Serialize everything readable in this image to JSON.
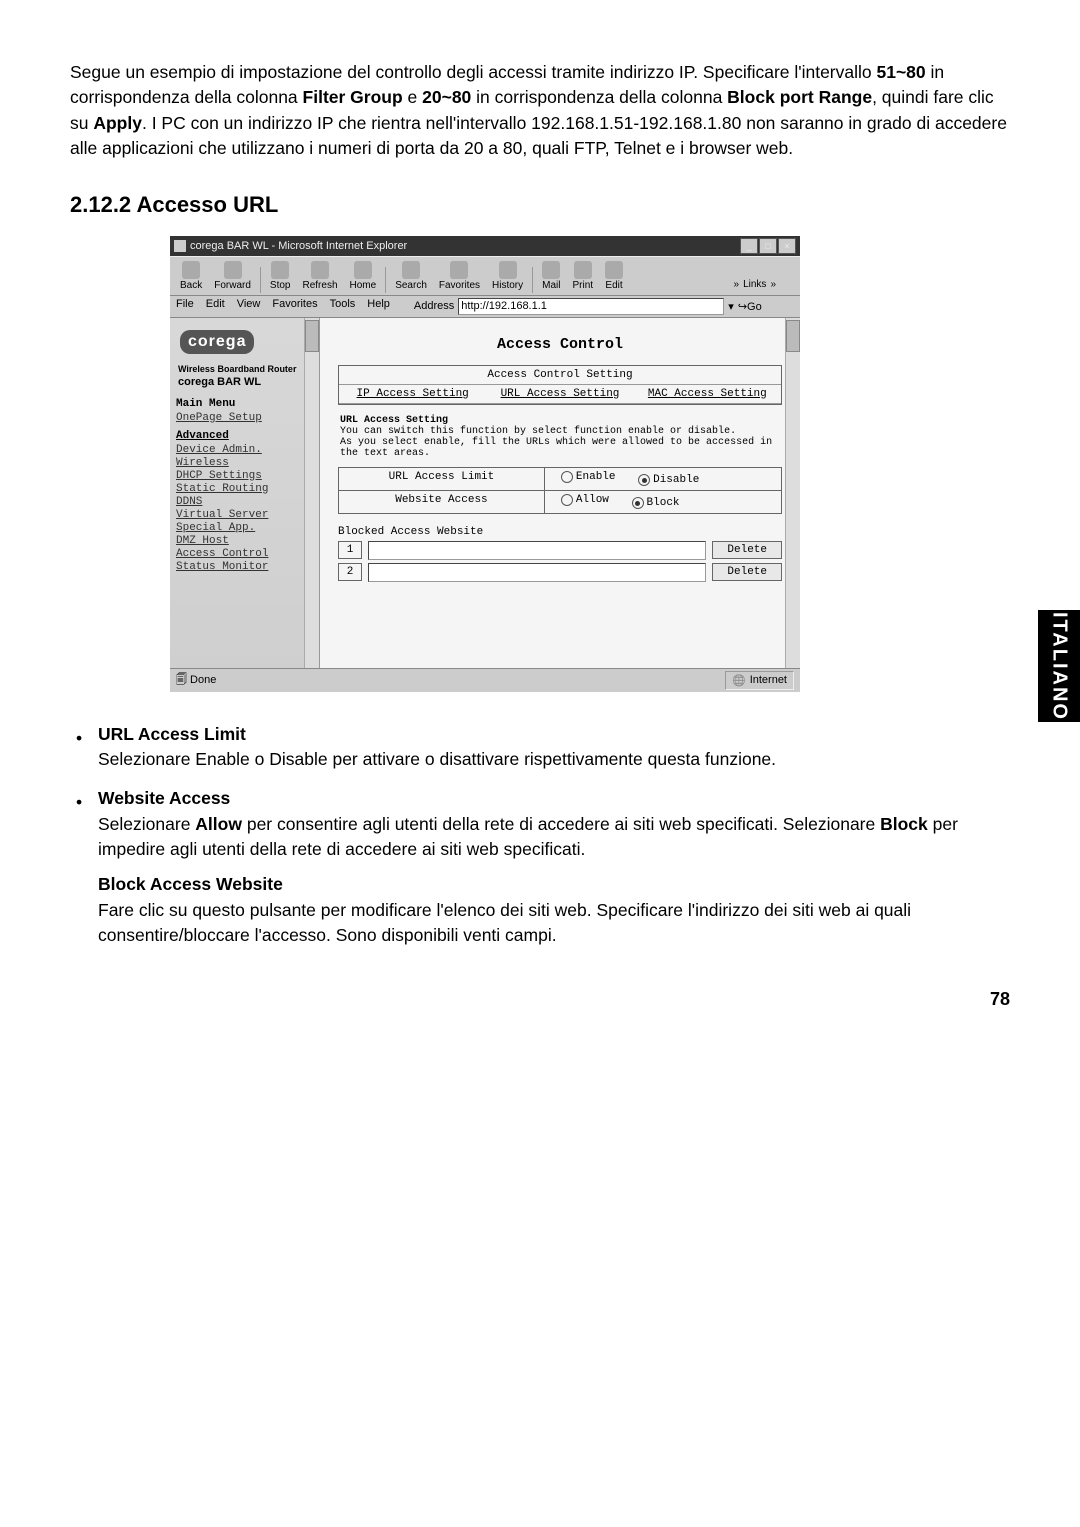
{
  "intro": {
    "p1a": "Segue un esempio di impostazione del controllo degli accessi tramite indirizzo IP. Specificare l'intervallo ",
    "b1": "51~80",
    "p1b": " in corrispondenza della colonna ",
    "b2": "Filter Group",
    "p1c": " e ",
    "b3": "20~80",
    "p1d": " in corrispondenza della colonna ",
    "b4": "Block port Range",
    "p1e": ", quindi fare clic su ",
    "b5": "Apply",
    "p1f": ". I PC con un indirizzo IP che rientra nell'intervallo 192.168.1.51-192.168.1.80 non saranno in grado di accedere alle applicazioni che utilizzano i numeri di porta da 20 a 80, quali FTP, Telnet e i browser web."
  },
  "section_heading": "2.12.2 Accesso URL",
  "screenshot": {
    "titlebar": "corega BAR WL - Microsoft Internet Explorer",
    "toolbar": {
      "back": "Back",
      "forward": "Forward",
      "stop": "Stop",
      "refresh": "Refresh",
      "home": "Home",
      "search": "Search",
      "favorites": "Favorites",
      "history": "History",
      "mail": "Mail",
      "print": "Print",
      "edit": "Edit",
      "links": "Links"
    },
    "menubar": {
      "file": "File",
      "edit": "Edit",
      "view": "View",
      "favorites": "Favorites",
      "tools": "Tools",
      "help": "Help"
    },
    "address_label": "Address",
    "address_value": "http://192.168.1.1",
    "go": "Go",
    "sidebar": {
      "logo": "corega",
      "caption": "Wireless Boardband Router",
      "product": "corega BAR WL",
      "mainmenu": "Main Menu",
      "items": {
        "onepage": "OnePage Setup",
        "advanced": "Advanced",
        "device": "Device Admin.",
        "wireless": "Wireless",
        "dhcp": "DHCP Settings",
        "static": "Static Routing",
        "ddns": "DDNS",
        "virtual": "Virtual Server",
        "special": "Special App.",
        "dmz": "DMZ Host",
        "access": "Access Control",
        "status": "Status Monitor"
      }
    },
    "main": {
      "heading": "Access Control",
      "tab_header": "Access Control Setting",
      "tabs": {
        "ip": "IP Access Setting",
        "url": "URL Access Setting",
        "mac": "MAC Access Setting"
      },
      "desc_head": "URL Access Setting",
      "desc1": "You can switch this function by select function enable or disable.",
      "desc2": "As you select enable, fill the URLs which were allowed to be accessed in the text areas.",
      "row1_label": "URL Access Limit",
      "row1_opts": {
        "enable": "Enable",
        "disable": "Disable"
      },
      "row2_label": "Website Access",
      "row2_opts": {
        "allow": "Allow",
        "block": "Block"
      },
      "blocked_head": "Blocked Access Website",
      "rows": [
        {
          "n": "1",
          "del": "Delete"
        },
        {
          "n": "2",
          "del": "Delete"
        }
      ]
    },
    "status": {
      "done": "Done",
      "zone": "Internet"
    }
  },
  "bullets": {
    "item1": {
      "title": "URL Access Limit",
      "text": "Selezionare Enable o Disable per attivare o disattivare rispettivamente questa funzione."
    },
    "item2": {
      "title": "Website Access",
      "text_a": "Selezionare ",
      "b1": "Allow",
      "text_b": " per consentire agli utenti della rete di accedere ai siti web specificati. Selezionare ",
      "b2": "Block",
      "text_c": " per impedire agli utenti della rete di accedere ai siti web specificati."
    },
    "item3": {
      "title": "Block Access Website",
      "text": "Fare clic su questo pulsante per modificare l'elenco dei siti web. Specificare l'indirizzo dei siti web ai quali consentire/bloccare l'accesso. Sono disponibili venti campi."
    }
  },
  "sidetab": "ITALIANO",
  "pagenum": "78"
}
